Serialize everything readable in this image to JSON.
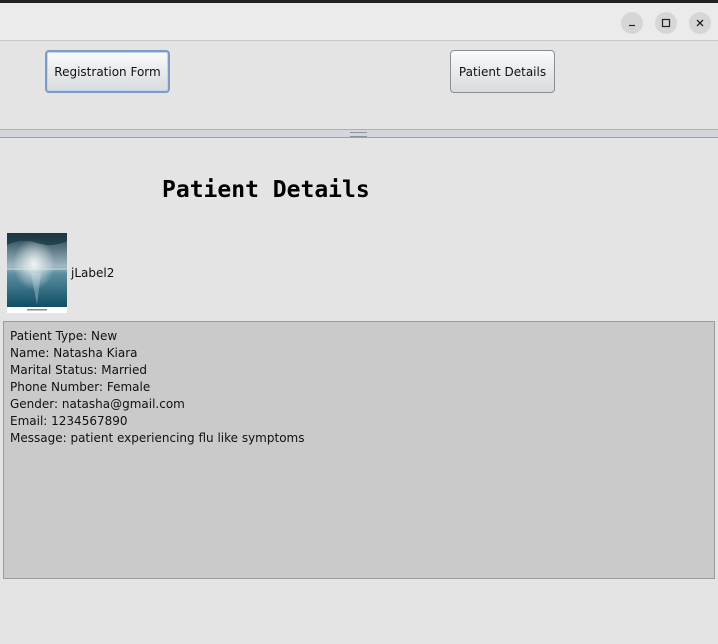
{
  "window": {
    "controls": [
      "minimize-icon",
      "maximize-icon",
      "close-icon"
    ]
  },
  "toolbar": {
    "registration_label": "Registration Form",
    "patient_details_label": "Patient Details"
  },
  "main": {
    "heading": "Patient Details",
    "image_label_text": "jLabel2",
    "details_lines": [
      "Patient Type: New",
      "Name: Natasha Kiara",
      "Marital Status: Married",
      "Phone Number: Female",
      "Gender: natasha@gmail.com",
      "Email: 1234567890",
      "Message: patient experiencing flu like symptoms"
    ]
  },
  "colors": {
    "background": "#e4e4e4",
    "text_area": "#cacaca",
    "focus_border": "#7b9cc4"
  }
}
